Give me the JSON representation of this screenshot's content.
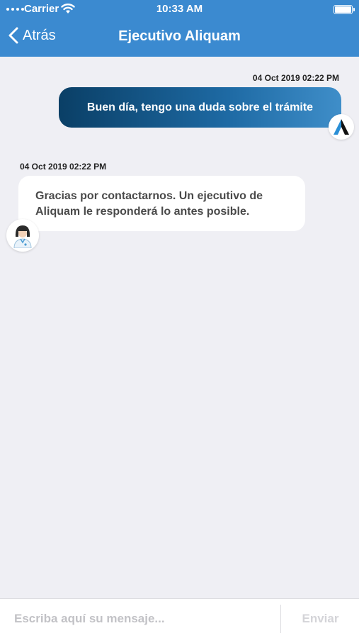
{
  "status_bar": {
    "carrier": "Carrier",
    "time": "10:33 AM"
  },
  "nav": {
    "back_label": "Atrás",
    "title": "Ejecutivo Aliquam"
  },
  "messages": [
    {
      "direction": "outgoing",
      "timestamp": "04 Oct 2019 02:22 PM",
      "text": "Buen día, tengo una duda sobre el trámite"
    },
    {
      "direction": "incoming",
      "timestamp": "04 Oct 2019 02:22 PM",
      "text": "Gracias por contactarnos. Un ejecutivo de Aliquam le responderá lo antes posible."
    }
  ],
  "composer": {
    "placeholder": "Escriba aquí su mensaje...",
    "value": "",
    "send_label": "Enviar"
  },
  "colors": {
    "header": "#3b8ad0",
    "background": "#efeff4",
    "outgoing_start": "#0a3f66",
    "outgoing_end": "#3f8ec9"
  }
}
